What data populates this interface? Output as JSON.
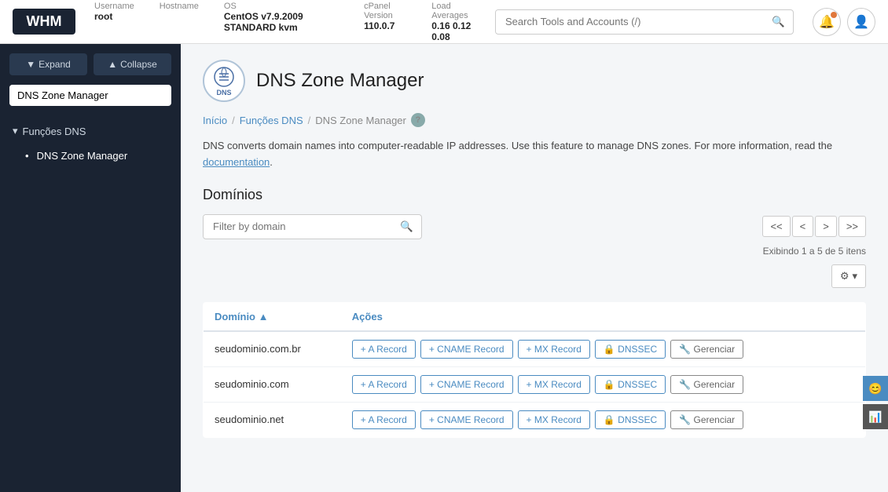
{
  "topbar": {
    "logo": "WHM",
    "meta": [
      {
        "label": "Username",
        "value": "root"
      },
      {
        "label": "Hostname",
        "value": ""
      },
      {
        "label": "OS",
        "value": "CentOS v7.9.2009 STANDARD kvm"
      },
      {
        "label": "cPanel Version",
        "value": "110.0.7"
      },
      {
        "label": "Load Averages",
        "value": "0.16  0.12  0.08"
      }
    ],
    "search_placeholder": "Search Tools and Accounts (/)"
  },
  "sidebar": {
    "expand_label": "Expand",
    "collapse_label": "Collapse",
    "search_value": "DNS Zone Manager",
    "category": "Funções DNS",
    "nav_item": "DNS Zone Manager"
  },
  "page": {
    "icon_text": "DNS",
    "title": "DNS Zone Manager",
    "breadcrumb": [
      {
        "text": "Início",
        "link": true
      },
      {
        "text": "Funções DNS",
        "link": true
      },
      {
        "text": "DNS Zone Manager",
        "link": false
      }
    ],
    "description": "DNS converts domain names into computer-readable IP addresses. Use this feature to manage DNS zones. For more information, read the",
    "description_link": "documentation",
    "section_title": "Domínios",
    "filter_placeholder": "Filter by domain",
    "pagination_info": "Exibindo 1 a 5 de 5 itens",
    "pagination": {
      "first": "<<",
      "prev": "<",
      "next": ">",
      "last": ">>"
    },
    "table": {
      "col_domain": "Domínio",
      "col_actions": "Ações",
      "rows": [
        {
          "domain": "seudominio.com.br",
          "actions": [
            {
              "label": "+ A Record",
              "type": "blue"
            },
            {
              "label": "+ CNAME Record",
              "type": "blue"
            },
            {
              "label": "+ MX Record",
              "type": "blue"
            },
            {
              "label": "🔒 DNSSEC",
              "type": "blue"
            },
            {
              "label": "🔧 Gerenciar",
              "type": "gray"
            }
          ]
        },
        {
          "domain": "seudominio.com",
          "actions": [
            {
              "label": "+ A Record",
              "type": "blue"
            },
            {
              "label": "+ CNAME Record",
              "type": "blue"
            },
            {
              "label": "+ MX Record",
              "type": "blue"
            },
            {
              "label": "🔒 DNSSEC",
              "type": "blue"
            },
            {
              "label": "🔧 Gerenciar",
              "type": "gray"
            }
          ]
        },
        {
          "domain": "seudominio.net",
          "actions": [
            {
              "label": "+ A Record",
              "type": "blue"
            },
            {
              "label": "+ CNAME Record",
              "type": "blue"
            },
            {
              "label": "+ MX Record",
              "type": "blue"
            },
            {
              "label": "🔒 DNSSEC",
              "type": "blue"
            },
            {
              "label": "🔧 Gerenciar",
              "type": "gray"
            }
          ]
        }
      ]
    }
  }
}
